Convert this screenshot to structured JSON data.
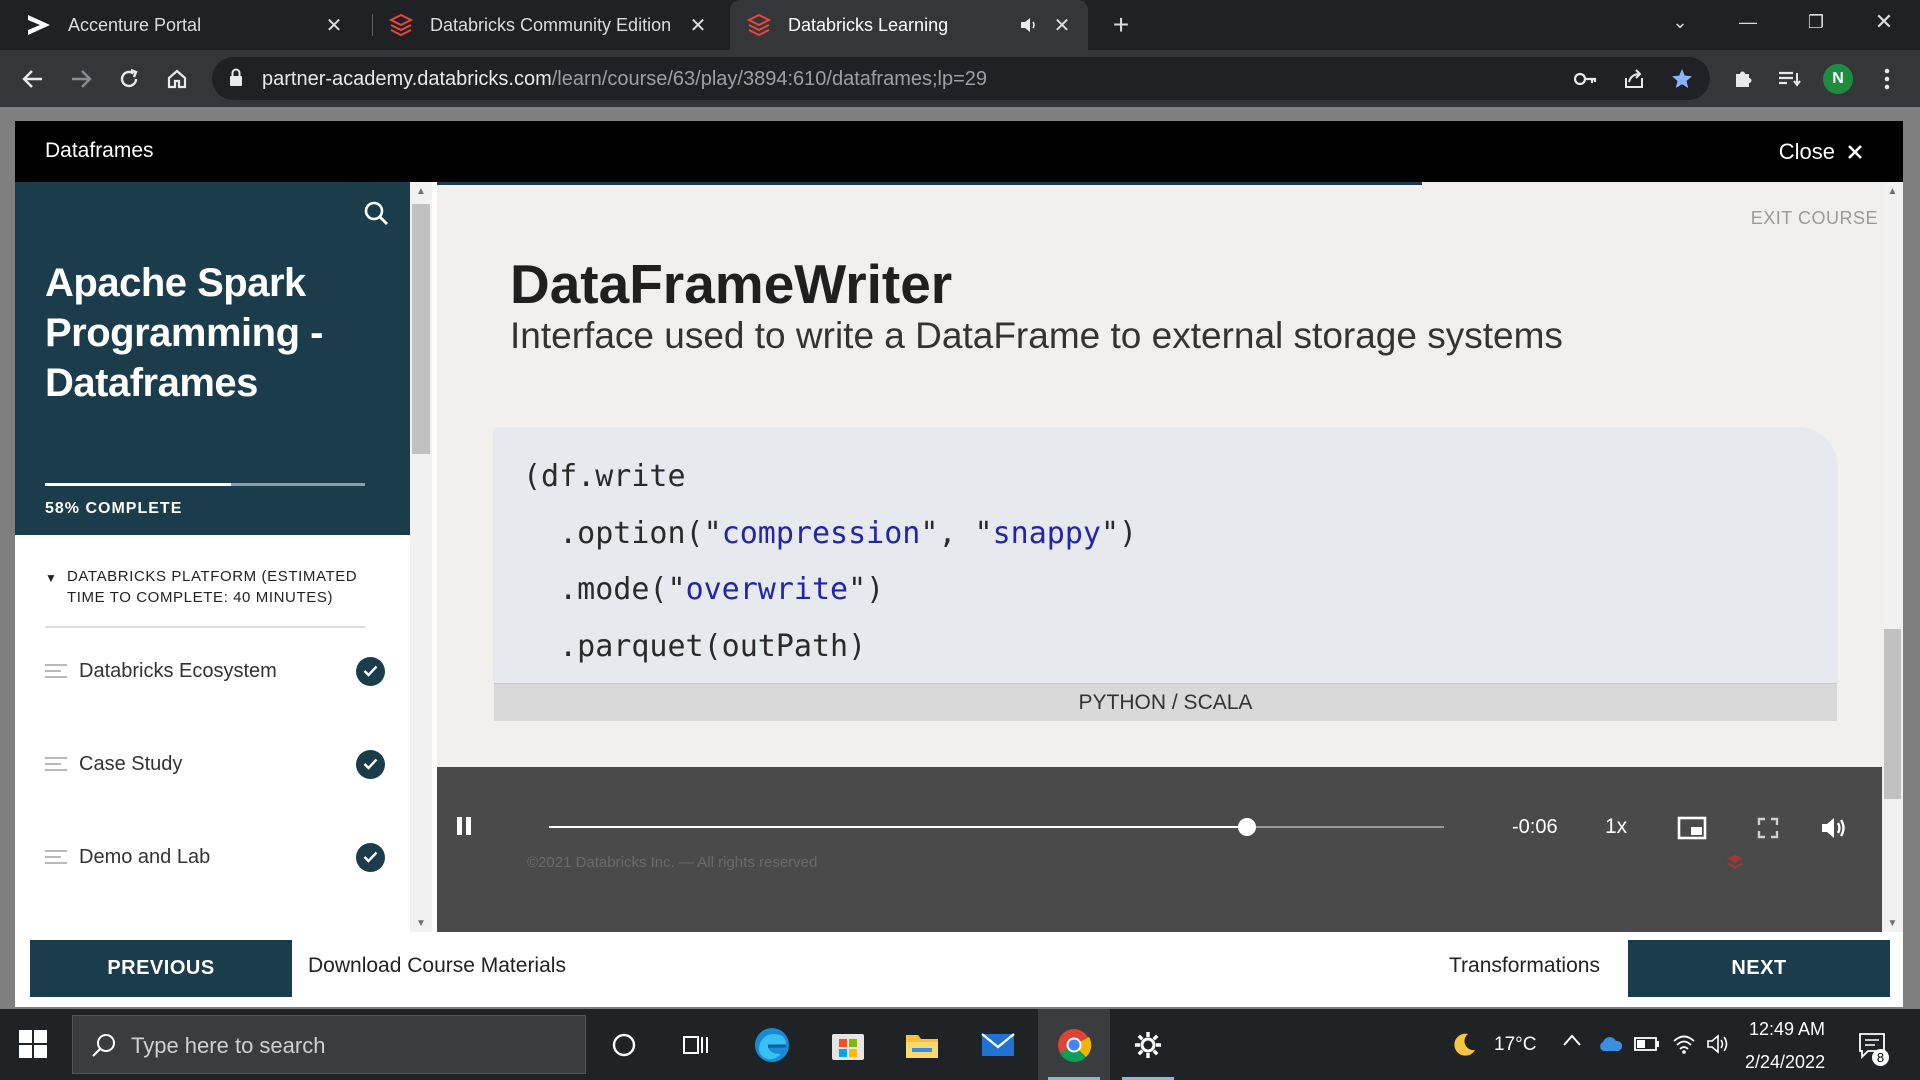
{
  "browser": {
    "tabs": [
      {
        "label": "Accenture Portal",
        "icon": "accenture-icon",
        "active": false
      },
      {
        "label": "Databricks Community Edition",
        "icon": "databricks-icon",
        "active": false
      },
      {
        "label": "Databricks Learning",
        "icon": "databricks-icon",
        "active": true,
        "audio": "speaker-icon"
      }
    ],
    "new_tab": "+",
    "url_host": "partner-academy.databricks.com",
    "url_path": "/learn/course/63/play/3894:610/dataframes;lp=29",
    "profile_initial": "N"
  },
  "modal": {
    "title": "Dataframes",
    "close_label": "Close"
  },
  "sidebar": {
    "course_title": "Apache Spark Programming - Dataframes",
    "progress_percent": 58,
    "progress_text": "58% COMPLETE",
    "section_heading": "DATABRICKS PLATFORM (ESTIMATED TIME TO COMPLETE: 40 MINUTES)",
    "lessons": [
      {
        "label": "Databricks Ecosystem",
        "completed": true
      },
      {
        "label": "Case Study",
        "completed": true
      },
      {
        "label": "Demo and Lab",
        "completed": true
      }
    ]
  },
  "slide": {
    "exit_label": "EXIT COURSE",
    "title": "DataFrameWriter",
    "subtitle": "Interface used to write a DataFrame to external storage systems",
    "code": {
      "line1": "(df.write",
      "line2_pre": "  .option(\"",
      "line2_s1": "compression",
      "line2_mid": "\", \"",
      "line2_s2": "snappy",
      "line2_post": "\")",
      "line3_pre": "  .mode(\"",
      "line3_s1": "overwrite",
      "line3_post": "\")",
      "line4": "  .parquet(outPath)",
      "line5": ")"
    },
    "language_label": "PYTHON / SCALA"
  },
  "player": {
    "state": "playing",
    "progress_fraction": 0.78,
    "time_remaining": "-0:06",
    "speed": "1x",
    "copyright": "©2021 Databricks Inc. — All rights reserved"
  },
  "footer": {
    "previous_label": "PREVIOUS",
    "download_label": "Download Course Materials",
    "next_lesson_label": "Transformations",
    "next_label": "NEXT"
  },
  "taskbar": {
    "search_placeholder": "Type here to search",
    "weather_temp": "17°C",
    "time": "12:49 AM",
    "date": "2/24/2022",
    "notification_count": "8"
  },
  "colors": {
    "brand_dark": "#1b3c4a",
    "code_string": "#2424a8",
    "chrome_bg": "#202124"
  }
}
